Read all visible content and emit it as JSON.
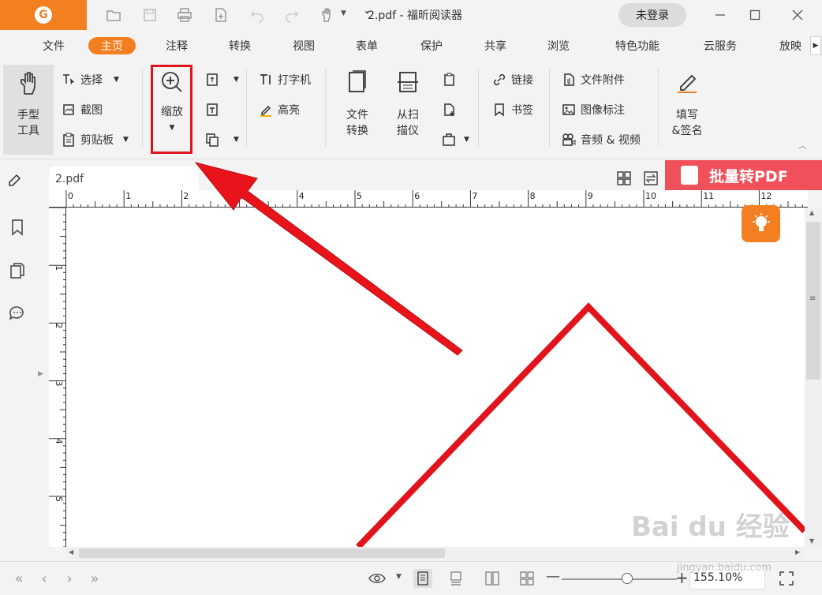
{
  "titlebar": {
    "doc_title": "2.pdf - 福昕阅读器",
    "login_label": "未登录"
  },
  "menu": {
    "tabs": [
      "文件",
      "主页",
      "注释",
      "转换",
      "视图",
      "表单",
      "保护",
      "共享",
      "浏览",
      "特色功能",
      "云服务",
      "放映"
    ],
    "active": "主页"
  },
  "ribbon": {
    "hand_tool": "手型\n工具",
    "select": "选择",
    "screenshot": "截图",
    "clipboard": "剪贴板",
    "zoom": "缩放",
    "typewriter": "打字机",
    "highlight": "高亮",
    "file_convert": "文件\n转换",
    "from_scanner": "从扫\n描仪",
    "link": "链接",
    "bookmark": "书签",
    "file_attachment": "文件附件",
    "image_annotation": "图像标注",
    "audio_video": "音频 & 视频",
    "fill_sign": "填写\n&签名"
  },
  "tabstrip": {
    "doc_tab": "2.pdf",
    "batch_banner": "批量转PDF"
  },
  "rulers": {
    "top_numbers": [
      "0",
      "1",
      "2",
      "3",
      "4",
      "5",
      "6",
      "7",
      "8",
      "9",
      "10",
      "11",
      "12"
    ],
    "left_numbers": [
      "1",
      "2",
      "3",
      "4",
      "5"
    ]
  },
  "statusbar": {
    "zoom_value": "155.10%"
  },
  "watermark": {
    "text": "Bai du 经验",
    "sub": "jingyan.baidu.com"
  },
  "colors": {
    "accent": "#f47f20",
    "annotation_red": "#e1141c",
    "banner": "#f0505a"
  }
}
